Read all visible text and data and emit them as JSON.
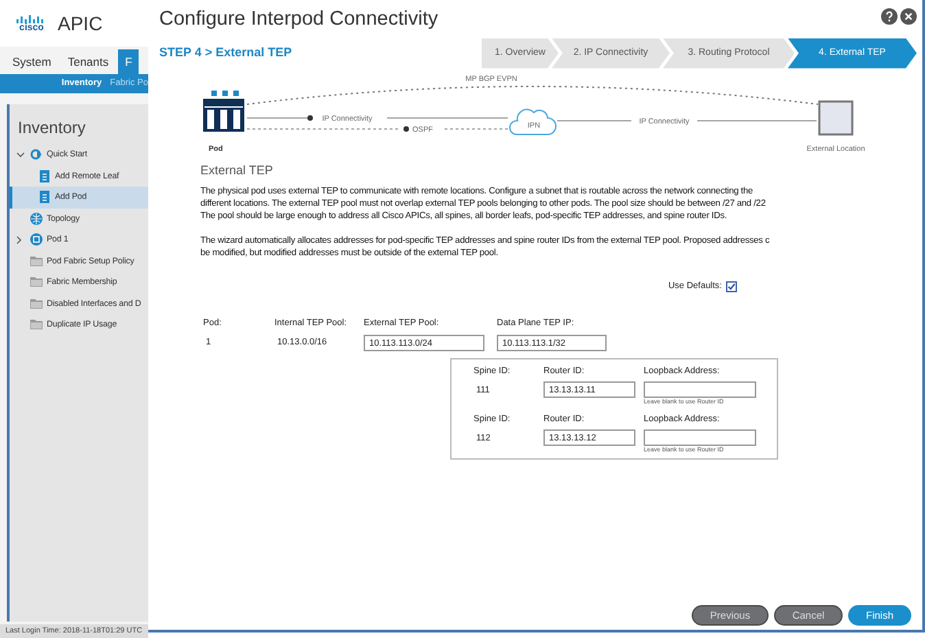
{
  "app": {
    "logo": "cisco",
    "title": "APIC",
    "tabs": [
      {
        "label": "System",
        "selected": false
      },
      {
        "label": "Tenants",
        "selected": false
      },
      {
        "label": "F",
        "selected": true
      }
    ],
    "subnav": [
      {
        "label": "Inventory",
        "selected": true
      },
      {
        "label": "Fabric Po",
        "selected": false
      }
    ],
    "sidebar": {
      "heading": "Inventory",
      "items": [
        {
          "label": "Quick Start",
          "kind": "quickstart",
          "expanded": true,
          "selected": false,
          "children": [
            {
              "label": "Add Remote Leaf",
              "kind": "document",
              "selected": false
            },
            {
              "label": "Add Pod",
              "kind": "document",
              "selected": true
            }
          ]
        },
        {
          "label": "Topology",
          "kind": "globe",
          "selected": false
        },
        {
          "label": "Pod 1",
          "kind": "pod",
          "expanded": false,
          "selected": false
        },
        {
          "label": "Pod Fabric Setup Policy",
          "kind": "folder",
          "selected": false
        },
        {
          "label": "Fabric Membership",
          "kind": "folder",
          "selected": false
        },
        {
          "label": "Disabled Interfaces and D",
          "kind": "folder",
          "selected": false
        },
        {
          "label": "Duplicate IP Usage",
          "kind": "folder",
          "selected": false
        }
      ]
    },
    "status_bar": "Last Login Time: 2018-11-18T01:29 UTC"
  },
  "dialog": {
    "title": "Configure Interpod Connectivity",
    "step_label": "STEP 4 > External TEP",
    "steps": [
      {
        "label": "1. Overview",
        "selected": false
      },
      {
        "label": "2. IP Connectivity",
        "selected": false
      },
      {
        "label": "3. Routing Protocol",
        "selected": false
      },
      {
        "label": "4. External TEP",
        "selected": true
      }
    ],
    "diagram": {
      "pod": "Pod",
      "bgp": "MP BGP EVPN",
      "ip_connectivity_left": "IP Connectivity",
      "ospf": "OSPF",
      "ipn": "IPN",
      "ip_connectivity_right": "IP Connectivity",
      "external": "External Location"
    },
    "section_title": "External TEP",
    "paragraphs": [
      "The physical pod uses external TEP to communicate with remote locations. Configure a subnet that is routable across the network connecting the\ndifferent locations. The external TEP pool must not overlap external TEP pools belonging to other pods. The pool size should be between /27 and /22\nThe pool should be large enough to address all Cisco APICs, all spines, all border leafs, pod-specific TEP addresses, and spine router IDs.",
      "The wizard automatically allocates addresses for pod-specific TEP addresses and spine router IDs from the external TEP pool. Proposed addresses c\nbe modified, but modified addresses must be outside of the external TEP pool."
    ],
    "use_defaults": {
      "label": "Use Defaults:",
      "checked": true
    },
    "pod_table": {
      "columns": [
        "Pod:",
        "Internal TEP Pool:",
        "External TEP Pool:",
        "Data Plane TEP IP:"
      ],
      "row": [
        "1",
        "10.13.0.0/16",
        "10.113.113.0/24",
        "10.113.113.1/32"
      ]
    },
    "spines": [
      {
        "spine_id_label": "Spine ID:",
        "spine_id": "111",
        "router_id_label": "Router ID:",
        "router_id": "13.13.13.11",
        "loopback_label": "Loopback Address:",
        "hint": "Leave blank to use Router ID"
      },
      {
        "spine_id_label": "Spine ID:",
        "spine_id": "112",
        "router_id_label": "Router ID:",
        "router_id": "13.13.13.12",
        "loopback_label": "Loopback Address:",
        "hint": "Leave blank to use Router ID"
      }
    ],
    "buttons": [
      {
        "label": "Previous",
        "kind": "secondary"
      },
      {
        "label": "Cancel",
        "kind": "secondary"
      },
      {
        "label": "Finish",
        "kind": "primary"
      }
    ]
  }
}
